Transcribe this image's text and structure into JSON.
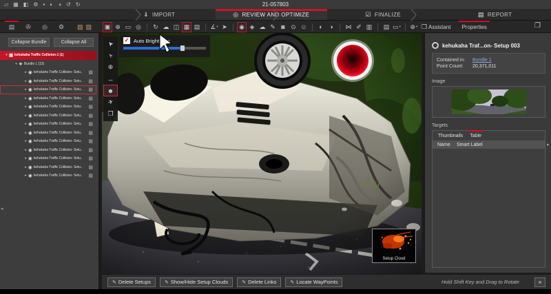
{
  "colors": {
    "accent_red": "#d11126",
    "link_blue": "#88acdf",
    "slider_blue": "#2a6fd4",
    "selection_red": "#c81527"
  },
  "title_bar": {
    "title": "21-057803",
    "quick_icons": [
      {
        "name": "new-project-icon",
        "glyph": "▱"
      },
      {
        "name": "save-icon",
        "glyph": "▦"
      },
      {
        "name": "import-data-icon",
        "glyph": "◧"
      },
      {
        "name": "settings-icon",
        "glyph": "⚙"
      },
      {
        "name": "stop-icon",
        "glyph": "▪"
      },
      {
        "name": "theme-icon",
        "glyph": "◐"
      },
      {
        "name": "contrast-icon",
        "glyph": "◑"
      },
      {
        "name": "undo-icon",
        "glyph": "↺"
      },
      {
        "name": "redo-icon",
        "glyph": "↻"
      }
    ]
  },
  "workflow": {
    "tabs": [
      {
        "label": "IMPORT",
        "icon": "⇓",
        "active": false
      },
      {
        "label": "REVIEW AND OPTIMIZE",
        "icon": "◎",
        "active": true
      },
      {
        "label": "FINALIZE",
        "icon": "☑",
        "active": false
      },
      {
        "label": "REPORT",
        "icon": "▤",
        "active": false
      }
    ]
  },
  "left_panel": {
    "tabs": [
      {
        "name": "tab-project-structure",
        "glyph": "▤",
        "active": true
      },
      {
        "name": "tab-attachments",
        "glyph": "✇",
        "active": false
      },
      {
        "name": "tab-targets",
        "glyph": "◎",
        "active": false
      },
      {
        "name": "tab-processing-settings",
        "glyph": "⚙",
        "active": false
      }
    ],
    "tab_toggles": [
      {
        "name": "toggle-image-list-icon",
        "glyph": "▧"
      },
      {
        "name": "toggle-image-grid-icon",
        "glyph": "▨"
      }
    ],
    "collapse_bundle_label": "Collapse Bundle",
    "collapse_all_label": "Collapse All",
    "tree": {
      "root_label": "kehukaha Traffic Collision-1 (1)",
      "bundle_label": "Bundle 1 (13)",
      "setup_label": "kehukaha Traffic Collision- Setu...",
      "setup_count": 13,
      "selected_setup": 3
    }
  },
  "toolbar": {
    "groups": [
      [
        {
          "name": "layout-tool",
          "glyph": "▣",
          "active": true
        },
        {
          "name": "pan-tool",
          "glyph": "⊕"
        },
        {
          "name": "marquee-select-tool",
          "glyph": "▭"
        },
        {
          "name": "zoom-tool",
          "glyph": "◎"
        }
      ],
      [
        {
          "name": "rotate-view-tool",
          "glyph": "↻"
        },
        {
          "name": "cloud-import-tool",
          "glyph": "☁"
        },
        {
          "name": "bubble-view-tool",
          "glyph": "◫"
        },
        {
          "name": "panorama-view-tool",
          "glyph": "▦",
          "active": true
        },
        {
          "name": "planar-view-tool",
          "glyph": "▤"
        }
      ],
      [
        {
          "name": "measure-tool",
          "glyph": "∡",
          "caret": true
        },
        {
          "name": "pick-point-tool",
          "glyph": "➤"
        }
      ],
      [
        {
          "name": "target-tool",
          "glyph": "◉",
          "active": true
        },
        {
          "name": "tag-tool",
          "glyph": "◈"
        },
        {
          "name": "cloud-tool",
          "glyph": "☁"
        },
        {
          "name": "annotate-tool",
          "glyph": "✎"
        },
        {
          "name": "snapshot-tool",
          "glyph": "◙"
        },
        {
          "name": "waypoint-tool",
          "glyph": "⊙"
        },
        {
          "name": "pedestrian-tool",
          "glyph": "☺"
        }
      ],
      [
        {
          "name": "globe-view-tool",
          "glyph": "◐"
        },
        {
          "name": "geo-reference-tool",
          "glyph": "◑"
        }
      ],
      [
        {
          "name": "link-setups-tool",
          "glyph": "⋈"
        },
        {
          "name": "draw-line-tool",
          "glyph": "✐"
        },
        {
          "name": "clipboard-tool",
          "glyph": "▥"
        }
      ],
      [
        {
          "name": "setup-document-tool",
          "glyph": "▤"
        },
        {
          "name": "view-rectangle-tool",
          "glyph": "▭",
          "caret": true
        }
      ],
      [
        {
          "name": "orbit-view-tool",
          "glyph": "⊕",
          "caret": true
        },
        {
          "name": "cloud-cube-tool",
          "glyph": "❒"
        }
      ]
    ]
  },
  "viewer": {
    "auto_brightness_label": "Auto Brightness",
    "auto_brightness_checked": true,
    "brightness_percent": 72,
    "check_glyph": "✓",
    "nav_tools": [
      {
        "name": "select-arrow-tool",
        "glyph": "➤",
        "rot": -135
      },
      {
        "name": "lasso-select-tool",
        "glyph": "➢",
        "rot": -135
      },
      {
        "name": "move-tool",
        "glyph": "⊕",
        "rot": 0
      },
      {
        "name": "measure-width-tool",
        "glyph": "↔",
        "rot": 0
      },
      {
        "name": "person-view-tool",
        "glyph": "☻",
        "rot": 0,
        "active": true
      },
      {
        "name": "fly-tool",
        "glyph": "✈",
        "rot": -20
      },
      {
        "name": "cube-view-tool",
        "glyph": "❒",
        "rot": 0
      }
    ],
    "setup_cloud_label": "Setup Cloud"
  },
  "right_panel": {
    "assistant_tab": "Assistant",
    "properties_tab": "Properties",
    "setup_title": "kehukaha Traf...on- Setup 003",
    "contained_in_label": "Contained in:",
    "contained_in_link": "Bundle 1",
    "point_count_label": "Point Count:",
    "point_count_value": "20,371,011",
    "image_label": "Image",
    "targets_label": "Targets",
    "thumbnails_tab": "Thumbnails",
    "table_tab": "Table",
    "table_headers": [
      "Name",
      "Smart Label"
    ]
  },
  "bottom_bar": {
    "buttons": [
      {
        "name": "delete-setups-button",
        "icon": "✎",
        "label": "Delete Setups"
      },
      {
        "name": "show-hide-setup-clouds-button",
        "icon": "✎",
        "label": "Show/Hide Setup Clouds"
      },
      {
        "name": "delete-links-button",
        "icon": "✎",
        "label": "Delete Links"
      },
      {
        "name": "locate-waypoints-button",
        "icon": "✎",
        "label": "Locate WayPoints"
      }
    ],
    "hint": "Hold Shift Key and Drag to Rotate",
    "close_label": "×"
  }
}
